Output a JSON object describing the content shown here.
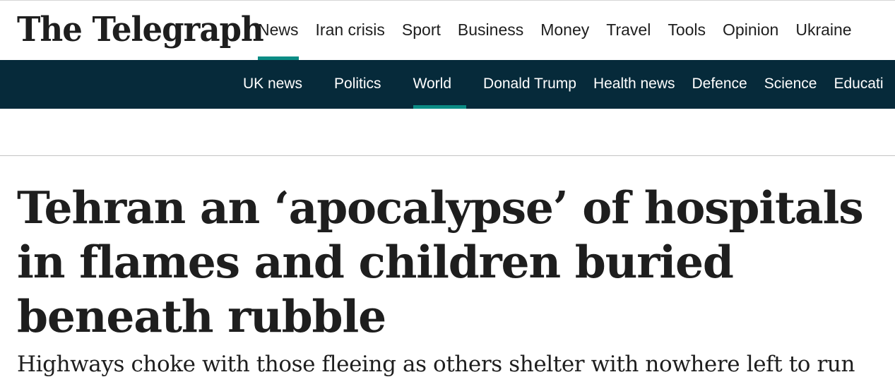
{
  "site": {
    "logo_text": "The Telegraph"
  },
  "top_nav": {
    "items": [
      {
        "label": "News",
        "active": true
      },
      {
        "label": "Iran crisis",
        "active": false
      },
      {
        "label": "Sport",
        "active": false
      },
      {
        "label": "Business",
        "active": false
      },
      {
        "label": "Money",
        "active": false
      },
      {
        "label": "Travel",
        "active": false
      },
      {
        "label": "Tools",
        "active": false
      },
      {
        "label": "Opinion",
        "active": false
      },
      {
        "label": "Ukraine",
        "active": false
      }
    ]
  },
  "sub_nav": {
    "items": [
      {
        "label": "UK news",
        "active": false
      },
      {
        "label": "Politics",
        "active": false
      },
      {
        "label": "World",
        "active": true
      },
      {
        "label": "Donald Trump",
        "active": false
      },
      {
        "label": "Health news",
        "active": false
      },
      {
        "label": "Defence",
        "active": false
      },
      {
        "label": "Science",
        "active": false
      },
      {
        "label": "Educati",
        "active": false
      }
    ]
  },
  "article": {
    "headline": "Tehran an ‘apocalypse’ of hospitals in flames and children buried beneath rubble",
    "standfirst": "Highways choke with those fleeing as others shelter with nowhere left to run"
  },
  "colors": {
    "accent": "#0b8c85",
    "sub_nav_background": "#062a3a",
    "text": "#1e1e1e"
  }
}
